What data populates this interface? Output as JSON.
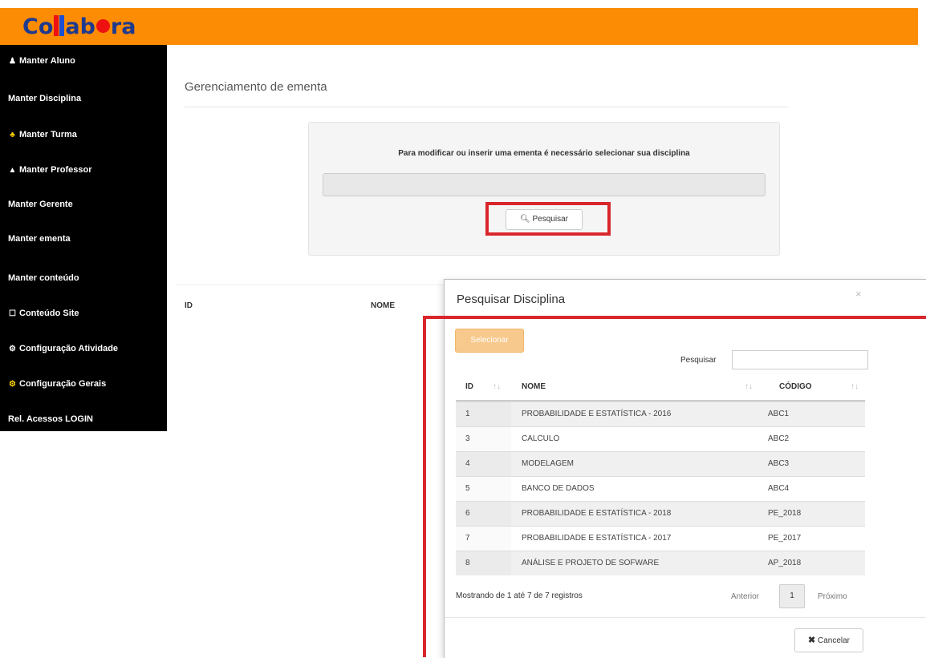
{
  "logo": {
    "text_a": "Co",
    "text_b": "ab",
    "text_c": "ra"
  },
  "sidebar": {
    "items": [
      {
        "label": "Manter Aluno",
        "icon": "user-icon",
        "glyph": "♟"
      },
      {
        "label": "Manter Disciplina",
        "icon": "",
        "glyph": ""
      },
      {
        "label": "Manter Turma",
        "icon": "users-icon",
        "glyph": "♣"
      },
      {
        "label": "Manter Professor",
        "icon": "graduation-cap-icon",
        "glyph": "▲"
      },
      {
        "label": "Manter Gerente",
        "icon": "",
        "glyph": ""
      },
      {
        "label": "Manter ementa",
        "icon": "",
        "glyph": ""
      },
      {
        "label": "Manter conteúdo",
        "icon": "",
        "glyph": ""
      },
      {
        "label": "Conteúdo Site",
        "icon": "square-icon",
        "glyph": "☐"
      },
      {
        "label": "Configuração Atividade",
        "icon": "gear-icon",
        "glyph": "⚙"
      },
      {
        "label": "Configuração Gerais",
        "icon": "gear-icon",
        "glyph": "⚙"
      },
      {
        "label": "Rel. Acessos LOGIN",
        "icon": "",
        "glyph": ""
      }
    ]
  },
  "main": {
    "title": "Gerenciamento de ementa",
    "panel_message": "Para modificar ou inserir uma ementa é necessário selecionar sua disciplina",
    "search_button": "Pesquisar",
    "table_headers": {
      "id": "ID",
      "nome": "NOME"
    }
  },
  "modal": {
    "title": "Pesquisar Disciplina",
    "close": "×",
    "select_button": "Selecionar",
    "search_label": "Pesquisar",
    "search_value": "",
    "columns": {
      "id": "ID",
      "nome": "NOME",
      "codigo": "CÓDIGO"
    },
    "rows": [
      {
        "id": "1",
        "nome": "PROBABILIDADE E ESTATÍSTICA - 2016",
        "codigo": "ABC1"
      },
      {
        "id": "3",
        "nome": "CALCULO",
        "codigo": "ABC2"
      },
      {
        "id": "4",
        "nome": "MODELAGEM",
        "codigo": "ABC3"
      },
      {
        "id": "5",
        "nome": "BANCO DE DADOS",
        "codigo": "ABC4"
      },
      {
        "id": "6",
        "nome": "PROBABILIDADE E ESTATÍSTICA - 2018",
        "codigo": "PE_2018"
      },
      {
        "id": "7",
        "nome": "PROBABILIDADE E ESTATÍSTICA - 2017",
        "codigo": "PE_2017"
      },
      {
        "id": "8",
        "nome": "ANÁLISE E PROJETO DE SOFWARE",
        "codigo": "AP_2018"
      }
    ],
    "info": "Mostrando de 1 até 7 de 7 registros",
    "pagination": {
      "prev": "Anterior",
      "page": "1",
      "next": "Próximo"
    },
    "cancel_button": "Cancelar"
  },
  "colors": {
    "topbar": "#fc8c04",
    "sidebar": "#000000",
    "highlight": "#d9262c",
    "select_button": "#f7c98c"
  }
}
